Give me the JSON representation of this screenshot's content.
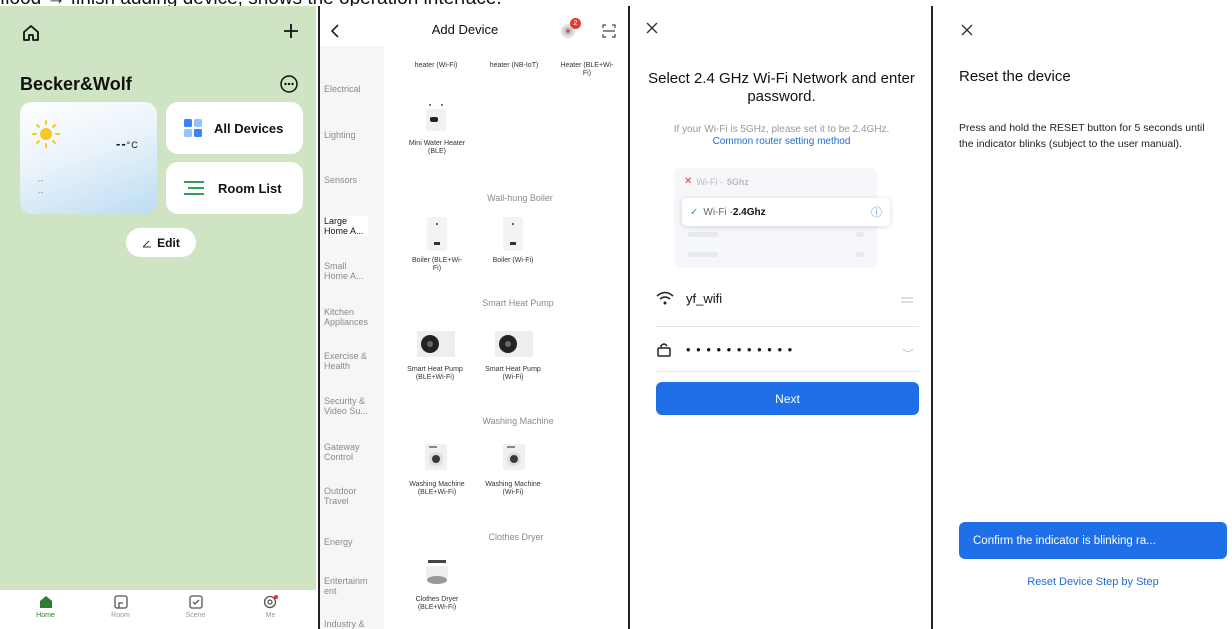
{
  "caption": "flood → finish adding device, shows the operation interface.",
  "home": {
    "brand": "Becker&Wolf",
    "temp": "--",
    "temp_unit": "°C",
    "weather_line1": "--",
    "weather_line2": "--",
    "all_devices": "All Devices",
    "room_list": "Room List",
    "edit": "Edit",
    "tabs": [
      {
        "label": "Home",
        "icon": "home-icon",
        "active": true
      },
      {
        "label": "Room",
        "icon": "room-icon",
        "active": false
      },
      {
        "label": "Scene",
        "icon": "scene-icon",
        "active": false
      },
      {
        "label": "Me",
        "icon": "me-icon",
        "active": false
      }
    ],
    "colors": {
      "accent": "#2e7d32",
      "background": "#cfe4c2"
    }
  },
  "add_device": {
    "title": "Add Device",
    "badge_count": "2",
    "categories": [
      "Electrical",
      "Lighting",
      "Sensors",
      "Large Home A...",
      "Small Home A...",
      "Kitchen Appliances",
      "Exercise & Health",
      "Security & Video Su...",
      "Gateway Control",
      "Outdoor Travel",
      "Energy",
      "Entertainm ent",
      "Industry &"
    ],
    "active_category": "Large Home A...",
    "top_devices": [
      "heater (Wi-Fi)",
      "heater (NB-IoT)",
      "Heater (BLE+Wi-Fi)"
    ],
    "mini_heater": "Mini Water Heater (BLE)",
    "sections": {
      "boiler": "Wall-hung Boiler",
      "pump": "Smart Heat Pump",
      "washer": "Washing Machine",
      "dryer": "Clothes Dryer"
    },
    "boilers": [
      "Boiler (BLE+Wi-Fi)",
      "Boiler (Wi-Fi)"
    ],
    "pumps": [
      "Smart Heat Pump (BLE+Wi-Fi)",
      "Smart Heat Pump (Wi-Fi)"
    ],
    "washers": [
      "Washing Machine (BLE+Wi-Fi)",
      "Washing Machine (Wi-Fi)"
    ],
    "dryer": "Clothes Dryer (BLE+Wi-Fi)"
  },
  "wifi": {
    "title": "Select 2.4 GHz Wi-Fi Network and enter password.",
    "note": "If your Wi-Fi is 5GHz, please set it to be 2.4GHz.",
    "link": "Common router setting method",
    "bad_net_prefix": "Wi-Fi - ",
    "bad_net_band": "5Ghz",
    "good_net_prefix": "Wi-Fi - ",
    "good_net_band": "2.4Ghz",
    "ssid": "yf_wifi",
    "password": "• • • • • • • • • • •",
    "next": "Next",
    "colors": {
      "primary": "#1e6fe8",
      "error": "#e53935",
      "ok": "#2eaa5a"
    }
  },
  "reset": {
    "title": "Reset the device",
    "body": "Press and hold the RESET button for 5 seconds until the indicator blinks (subject to the user manual).",
    "confirm": "Confirm the indicator is blinking ra...",
    "step_link": "Reset Device Step by Step"
  }
}
